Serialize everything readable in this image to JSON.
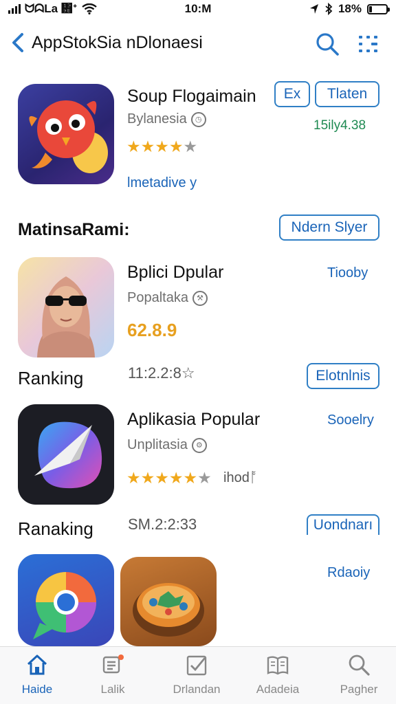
{
  "status_bar": {
    "carrier": "ᗢᗣLa ᎛ᐩ",
    "time": "10:M",
    "battery": "18%",
    "battery_fraction": 0.18
  },
  "nav": {
    "title": "AppStokSia nDlonaesi"
  },
  "featured_app": {
    "name": "Soup Flogaimain",
    "developer": "Bylanesia",
    "rating_stars": 4,
    "badge_button": "Ex",
    "get_button": "Tlaten",
    "price_text": "15ily4.38",
    "link": "lmetadive y"
  },
  "section": {
    "heading": "MatinsaRami:",
    "header_button": "Ndern Slyer"
  },
  "apps": [
    {
      "name": "Bplici Dpular",
      "developer": "Popaltaka",
      "rating_value": "62.8.9",
      "action": "Tiooby",
      "ranking_label": "Ranking",
      "ranking_value": "11:2.2:8☆",
      "ranking_button": "Elotnlnis"
    },
    {
      "name": "Aplikasia Popular",
      "developer": "Unplitasia",
      "rating_stars": 5,
      "rating_extra": "ihodᚩ",
      "action": "Sooelry",
      "ranking_label": "Ranaking",
      "ranking_value": "SM.2:2:33",
      "ranking_button": "Uondnarı"
    },
    {
      "action": "Rdaoiy"
    }
  ],
  "tab_bar": {
    "tabs": [
      {
        "label": "Haide",
        "icon": "home-icon",
        "active": true
      },
      {
        "label": "Lalik",
        "icon": "list-icon",
        "active": false
      },
      {
        "label": "Drlandan",
        "icon": "checkbox-icon",
        "active": false
      },
      {
        "label": "Adadeia",
        "icon": "book-icon",
        "active": false
      },
      {
        "label": "Pagher",
        "icon": "search-icon",
        "active": false
      }
    ]
  },
  "colors": {
    "accent": "#1a64b8",
    "star": "#f0a81c",
    "price_green": "#1f8a52"
  }
}
